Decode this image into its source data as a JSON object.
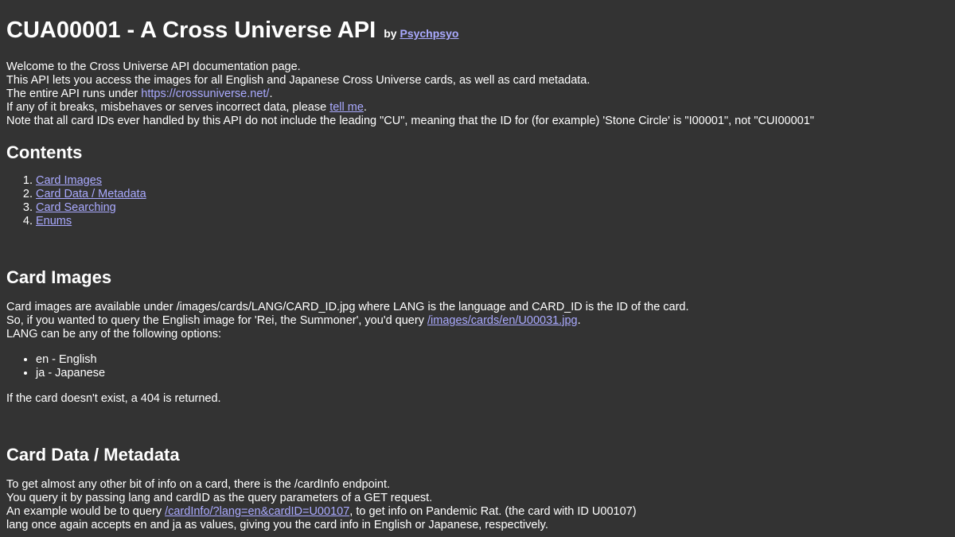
{
  "header": {
    "title": "CUA00001 - A Cross Universe API",
    "by_label": "by",
    "author_link": "Psychpsyo"
  },
  "intro": {
    "line1": "Welcome to the Cross Universe API documentation page.",
    "line2": "This API lets you access the images for all English and Japanese Cross Universe cards, as well as card metadata.",
    "line3_prefix": "The entire API runs under ",
    "line3_link": "https://crossuniverse.net/",
    "line3_suffix": ".",
    "line4_prefix": "If any of it breaks, misbehaves or serves incorrect data, please ",
    "line4_link": "tell me",
    "line4_suffix": ".",
    "line5": "Note that all card IDs ever handled by this API do not include the leading \"CU\", meaning that the ID for (for example) 'Stone Circle' is \"I00001\", not \"CUI00001\""
  },
  "contents": {
    "heading": "Contents",
    "items": [
      {
        "number": "1.",
        "label": "Card Images"
      },
      {
        "number": "2.",
        "label": "Card Data / Metadata"
      },
      {
        "number": "3.",
        "label": "Card Searching"
      },
      {
        "number": "4.",
        "label": "Enums"
      }
    ]
  },
  "card_images": {
    "heading": "Card Images",
    "line1": "Card images are available under /images/cards/LANG/CARD_ID.jpg where LANG is the language and CARD_ID is the ID of the card.",
    "line2_prefix": "So, if you wanted to query the English image for 'Rei, the Summoner', you'd query ",
    "line2_link": "/images/cards/en/U00031.jpg",
    "line2_suffix": ".",
    "line3": "LANG can be any of the following options:",
    "options": [
      "en - English",
      "ja - Japanese"
    ],
    "not_found": "If the card doesn't exist, a 404 is returned."
  },
  "card_data": {
    "heading": "Card Data / Metadata",
    "line1": "To get almost any other bit of info on a card, there is the /cardInfo endpoint.",
    "line2": "You query it by passing lang and cardID as the query parameters of a GET request.",
    "line3_prefix": "An example would be to query ",
    "line3_link": "/cardInfo/?lang=en&cardID=U00107",
    "line3_suffix": ", to get info on Pandemic Rat. (the card with ID U00107)",
    "line4": "lang once again accepts en and ja as values, giving you the card info in English or Japanese, respectively."
  },
  "colors": {
    "background": "#333333",
    "text": "#ffffff",
    "link": "#aaaaff"
  }
}
